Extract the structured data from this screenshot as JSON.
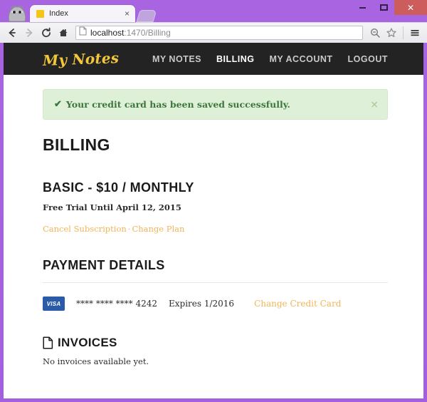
{
  "browser": {
    "tab": {
      "title": "Index",
      "favicon_color": "#f5c518",
      "close_label": "×"
    },
    "window_controls": {
      "minimize": "",
      "maximize": "",
      "close": "✕"
    },
    "toolbar": {
      "back": "back-arrow",
      "forward": "forward-arrow",
      "reload": "reload",
      "home": "home",
      "zoom": "magnifier",
      "bookmark": "star",
      "menu": "hamburger"
    },
    "address": {
      "host": "localhost",
      "path": ":1470/Billing",
      "full": "localhost:1470/Billing"
    }
  },
  "site": {
    "brand": "My Notes",
    "nav": [
      {
        "label": "MY NOTES",
        "active": false
      },
      {
        "label": "BILLING",
        "active": true
      },
      {
        "label": "MY ACCOUNT",
        "active": false
      },
      {
        "label": "LOGOUT",
        "active": false
      }
    ]
  },
  "alert": {
    "icon": "✔",
    "message": "Your credit card has been saved successfully.",
    "close": "×",
    "background": "#dff0d8",
    "text_color": "#3c763d"
  },
  "page": {
    "title": "BILLING"
  },
  "plan": {
    "title": "BASIC - $10 / MONTHLY",
    "trial": "Free Trial Until April 12, 2015",
    "cancel_link": "Cancel Subscription",
    "separator": "·",
    "change_link": "Change Plan",
    "link_color": "#f0b557"
  },
  "payment": {
    "title": "PAYMENT DETAILS",
    "card_brand": "VISA",
    "card_brand_color": "#2a5aa8",
    "card_number": "**** **** **** 4242",
    "expires": "Expires 1/2016",
    "change_link": "Change Credit Card"
  },
  "invoices": {
    "title": "INVOICES",
    "icon": "document-icon",
    "empty_message": "No invoices available yet."
  }
}
